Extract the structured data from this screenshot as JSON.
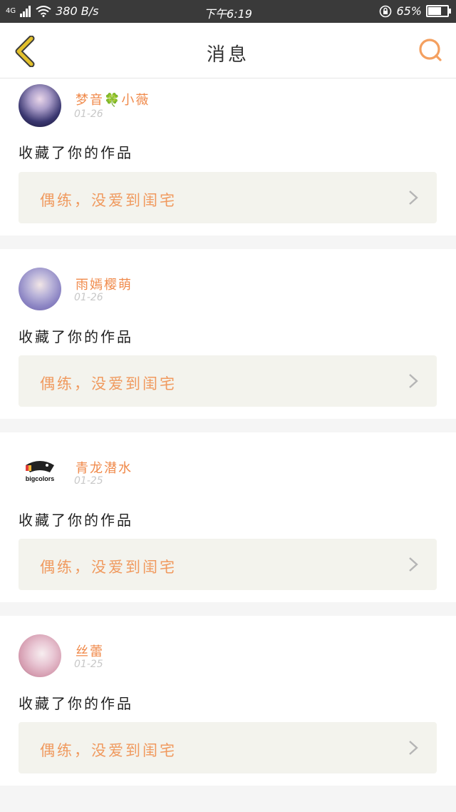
{
  "statusbar": {
    "network": "4G",
    "speed": "380 B/s",
    "time": "下午6:19",
    "battery": "65%",
    "battery_level": 0.65
  },
  "header": {
    "title": "消息"
  },
  "notifications": [
    {
      "username": "梦音🍀小薇",
      "date": "01-26",
      "action": "收藏了你的作品",
      "work_title": "偶练，没爱到闺宅"
    },
    {
      "username": "雨嫣樱萌",
      "date": "01-26",
      "action": "收藏了你的作品",
      "work_title": "偶练，没爱到闺宅"
    },
    {
      "username": "青龙潜水",
      "date": "01-25",
      "action": "收藏了你的作品",
      "work_title": "偶练，没爱到闺宅",
      "avatar_text": "bigcolors"
    },
    {
      "username": "丝蕾",
      "date": "01-25",
      "action": "收藏了你的作品",
      "work_title": "偶练，没爱到闺宅"
    }
  ],
  "colors": {
    "accent": "#f08a4b",
    "back_icon": "#e2c02b",
    "statusbar": "#3a3a3a"
  }
}
